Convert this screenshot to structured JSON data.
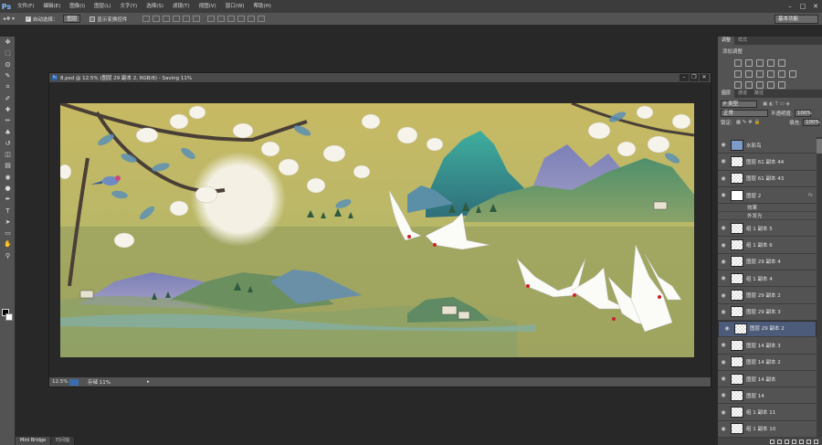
{
  "app": {
    "logo": "Ps"
  },
  "menu": [
    "文件(F)",
    "编辑(E)",
    "图像(I)",
    "图层(L)",
    "文字(Y)",
    "选择(S)",
    "滤镜(T)",
    "视图(V)",
    "窗口(W)",
    "帮助(H)"
  ],
  "window_controls": {
    "minimize": "–",
    "maximize": "□",
    "close": "✕"
  },
  "options_bar": {
    "auto_select_label": "自动选择：",
    "auto_select_value": "图层",
    "show_transform_label": "显示变换控件",
    "workspace": "基本功能"
  },
  "document": {
    "title": "8.psd @ 12.5% (图层 29 副本 2, RGB/8) - Saving 11%",
    "zoom": "12.5%",
    "status": "存储 11%",
    "controls": {
      "minimize": "–",
      "restore": "❐",
      "close": "✕"
    }
  },
  "bottom_tabs": [
    "Mini Bridge",
    "时间轴"
  ],
  "panels": {
    "top_tabs": [
      "调整",
      "样式"
    ],
    "adjust_title": "添加调整",
    "layer_tabs": [
      "图层",
      "通道",
      "路径"
    ],
    "filter_kind": "P 类型",
    "blend_mode": "正常",
    "opacity_label": "不透明度:",
    "opacity_value": "100%",
    "lock_label": "锁定:",
    "fill_label": "填充:",
    "fill_value": "100%",
    "layers": [
      {
        "name": "水彩鸟",
        "thumb": "bird",
        "selected": false
      },
      {
        "name": "图层 61 副本 44",
        "thumb": "check",
        "selected": false
      },
      {
        "name": "图层 61 副本 43",
        "thumb": "check",
        "selected": false
      },
      {
        "name": "图层 2",
        "thumb": "white",
        "selected": false,
        "fx": "fx",
        "effects": [
          "效果",
          "外发光"
        ]
      },
      {
        "name": "组 1 副本 5",
        "thumb": "check",
        "selected": false
      },
      {
        "name": "组 1 副本 6",
        "thumb": "check",
        "selected": false
      },
      {
        "name": "图层 29 副本 4",
        "thumb": "check",
        "selected": false
      },
      {
        "name": "组 1 副本 4",
        "thumb": "check",
        "selected": false
      },
      {
        "name": "图层 29 副本 2",
        "thumb": "check",
        "selected": false
      },
      {
        "name": "图层 29 副本 3",
        "thumb": "check",
        "selected": false
      },
      {
        "name": "图层 29 副本 2",
        "thumb": "check",
        "selected": true
      },
      {
        "name": "图层 14 副本 3",
        "thumb": "check",
        "selected": false
      },
      {
        "name": "图层 14 副本 2",
        "thumb": "check",
        "selected": false
      },
      {
        "name": "图层 14 副本",
        "thumb": "check",
        "selected": false
      },
      {
        "name": "图层 14",
        "thumb": "check",
        "selected": false
      },
      {
        "name": "组 1 副本 11",
        "thumb": "check",
        "selected": false
      },
      {
        "name": "组 1 副本 10",
        "thumb": "check",
        "selected": false
      }
    ]
  },
  "tools": [
    "move-tool",
    "marquee-tool",
    "lasso-tool",
    "quick-select-tool",
    "crop-tool",
    "eyedropper-tool",
    "healing-brush-tool",
    "brush-tool",
    "clone-stamp-tool",
    "history-brush-tool",
    "eraser-tool",
    "gradient-tool",
    "blur-tool",
    "dodge-tool",
    "pen-tool",
    "type-tool",
    "path-select-tool",
    "shape-tool",
    "hand-tool",
    "zoom-tool"
  ],
  "tool_glyphs": [
    "✥",
    "⬚",
    "ʘ",
    "✎",
    "⌗",
    "✐",
    "✚",
    "✏",
    "♣",
    "↺",
    "◫",
    "▤",
    "◉",
    "●",
    "✒",
    "T",
    "➤",
    "▭",
    "✋",
    "⚲"
  ],
  "colors": {
    "selected_layer": "#4c5b7a",
    "accent": "#3a6db0"
  }
}
